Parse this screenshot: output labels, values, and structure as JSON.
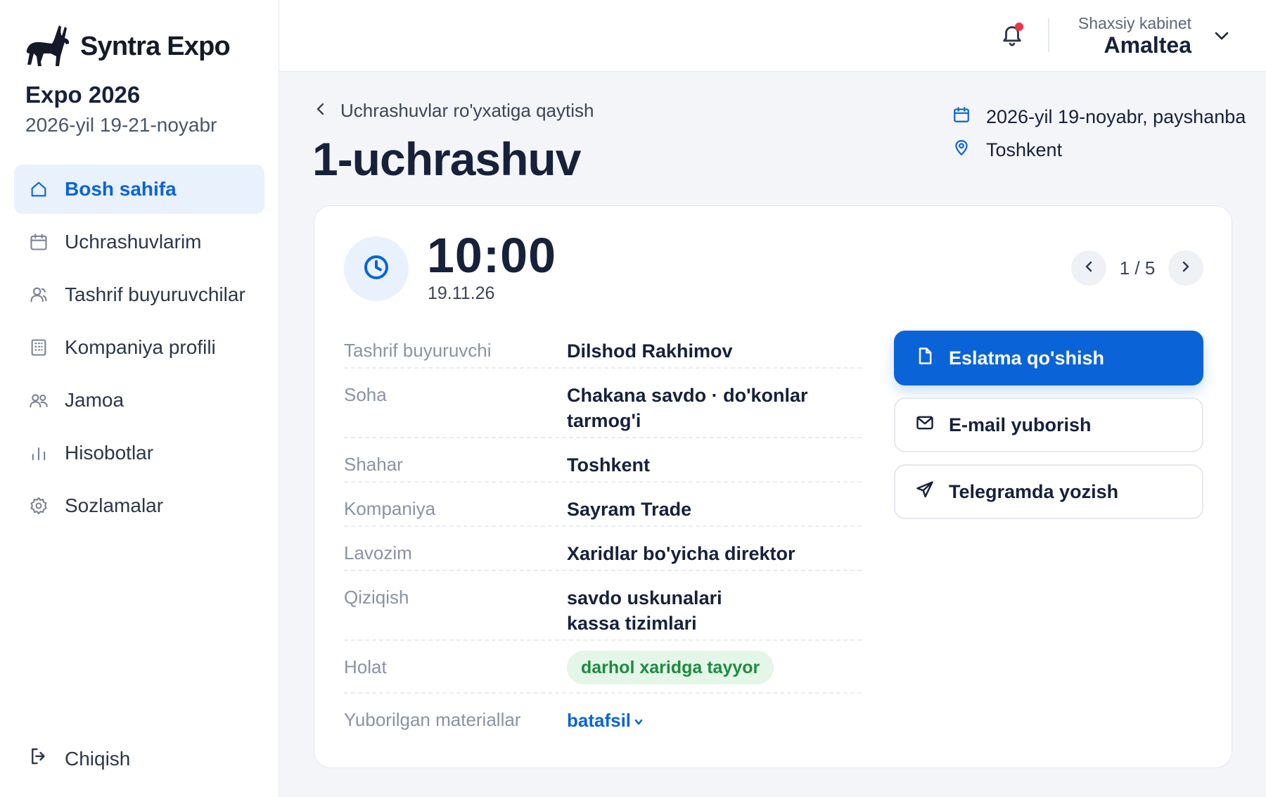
{
  "brand": {
    "name": "Syntra Expo",
    "logo_icon": "donkey-logo-icon"
  },
  "event": {
    "title": "Expo 2026",
    "dates": "2026-yil 19-21-noyabr"
  },
  "sidebar": {
    "items": [
      {
        "label": "Bosh sahifa",
        "icon": "home-icon",
        "active": true
      },
      {
        "label": "Uchrashuvlarim",
        "icon": "calendar-icon",
        "active": false
      },
      {
        "label": "Tashrif buyuruvchilar",
        "icon": "visitors-icon",
        "active": false
      },
      {
        "label": "Kompaniya profili",
        "icon": "building-icon",
        "active": false
      },
      {
        "label": "Jamoa",
        "icon": "team-icon",
        "active": false
      },
      {
        "label": "Hisobotlar",
        "icon": "bar-chart-icon",
        "active": false
      },
      {
        "label": "Sozlamalar",
        "icon": "gear-icon",
        "active": false
      }
    ],
    "logout_label": "Chiqish"
  },
  "topbar": {
    "account_label": "Shaxsiy kabinet",
    "account_name": "Amaltea",
    "has_notification": true
  },
  "header": {
    "back_label": "Uchrashuvlar ro'yxatiga qaytish",
    "title": "1-uchrashuv",
    "date": "2026-yil 19-noyabr, payshanba",
    "location": "Toshkent"
  },
  "meeting": {
    "time": "10:00",
    "date": "19.11.26",
    "pager": "1 / 5",
    "details": [
      {
        "label": "Tashrif buyuruvchi",
        "value": "Dilshod Rakhimov"
      },
      {
        "label": "Soha",
        "value": "Chakana savdo · do'konlar",
        "value2": "tarmog'i"
      },
      {
        "label": "Shahar",
        "value": "Toshkent"
      },
      {
        "label": "Kompaniya",
        "value": "Sayram Trade"
      },
      {
        "label": "Lavozim",
        "value": "Xaridlar bo'yicha direktor"
      },
      {
        "label": "Qiziqish",
        "value": "savdo uskunalari",
        "value2": "kassa tizimlari"
      },
      {
        "label": "Holat",
        "value": "darhol xaridga tayyor"
      },
      {
        "label": "Yuborilgan materiallar",
        "value": "batafsil"
      }
    ],
    "actions": {
      "note": "Eslatma qo'shish",
      "email": "E-mail yuborish",
      "telegram": "Telegramda yozish"
    }
  },
  "colors": {
    "accent": "#0a64d8",
    "active_bg": "#e9f1fd",
    "status_bg": "#e3f6e8",
    "status_text": "#1f8a42",
    "notification_dot": "#f0334a"
  }
}
